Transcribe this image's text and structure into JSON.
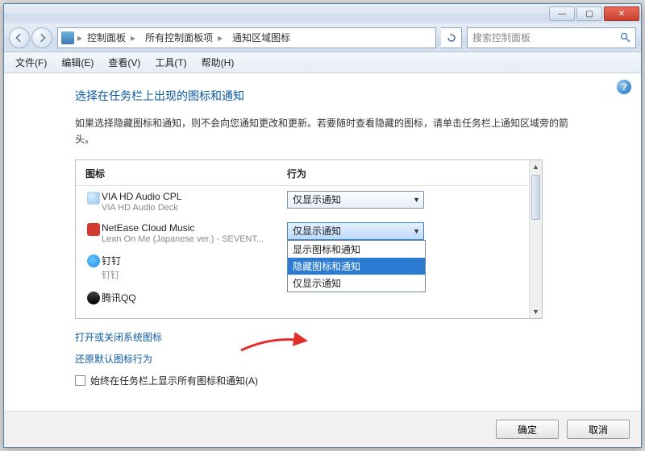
{
  "titlebar": {
    "min": "—",
    "max": "▢",
    "close": "✕"
  },
  "breadcrumb": {
    "items": [
      "控制面板",
      "所有控制面板项",
      "通知区域图标"
    ]
  },
  "search": {
    "placeholder": "搜索控制面板"
  },
  "menubar": {
    "items": [
      "文件(F)",
      "编辑(E)",
      "查看(V)",
      "工具(T)",
      "帮助(H)"
    ]
  },
  "page": {
    "title": "选择在任务栏上出现的图标和通知",
    "desc": "如果选择隐藏图标和通知，则不会向您通知更改和更新。若要随时查看隐藏的图标，请单击任务栏上通知区域旁的箭头。"
  },
  "list": {
    "headers": {
      "icon": "图标",
      "action": "行为"
    },
    "rows": [
      {
        "name": "VIA HD Audio CPL",
        "sub": "VIA HD Audio Deck",
        "action": "仅显示通知",
        "open": false,
        "icon": "via"
      },
      {
        "name": "NetEase Cloud Music",
        "sub": "Lean On Me (Japanese ver.) - SEVENT...",
        "action": "仅显示通知",
        "open": true,
        "icon": "netease"
      },
      {
        "name": "钉钉",
        "sub": "钉钉",
        "action": "",
        "open": false,
        "icon": "ding"
      },
      {
        "name": "腾讯QQ",
        "sub": "",
        "action": "",
        "open": false,
        "icon": "qq"
      }
    ],
    "dropdown": {
      "options": [
        "显示图标和通知",
        "隐藏图标和通知",
        "仅显示通知"
      ],
      "selected_index": 1
    }
  },
  "links": {
    "toggle": "打开或关闭系统图标",
    "restore": "还原默认图标行为"
  },
  "checkbox": {
    "label": "始终在任务栏上显示所有图标和通知(A)"
  },
  "footer": {
    "ok": "确定",
    "cancel": "取消"
  }
}
